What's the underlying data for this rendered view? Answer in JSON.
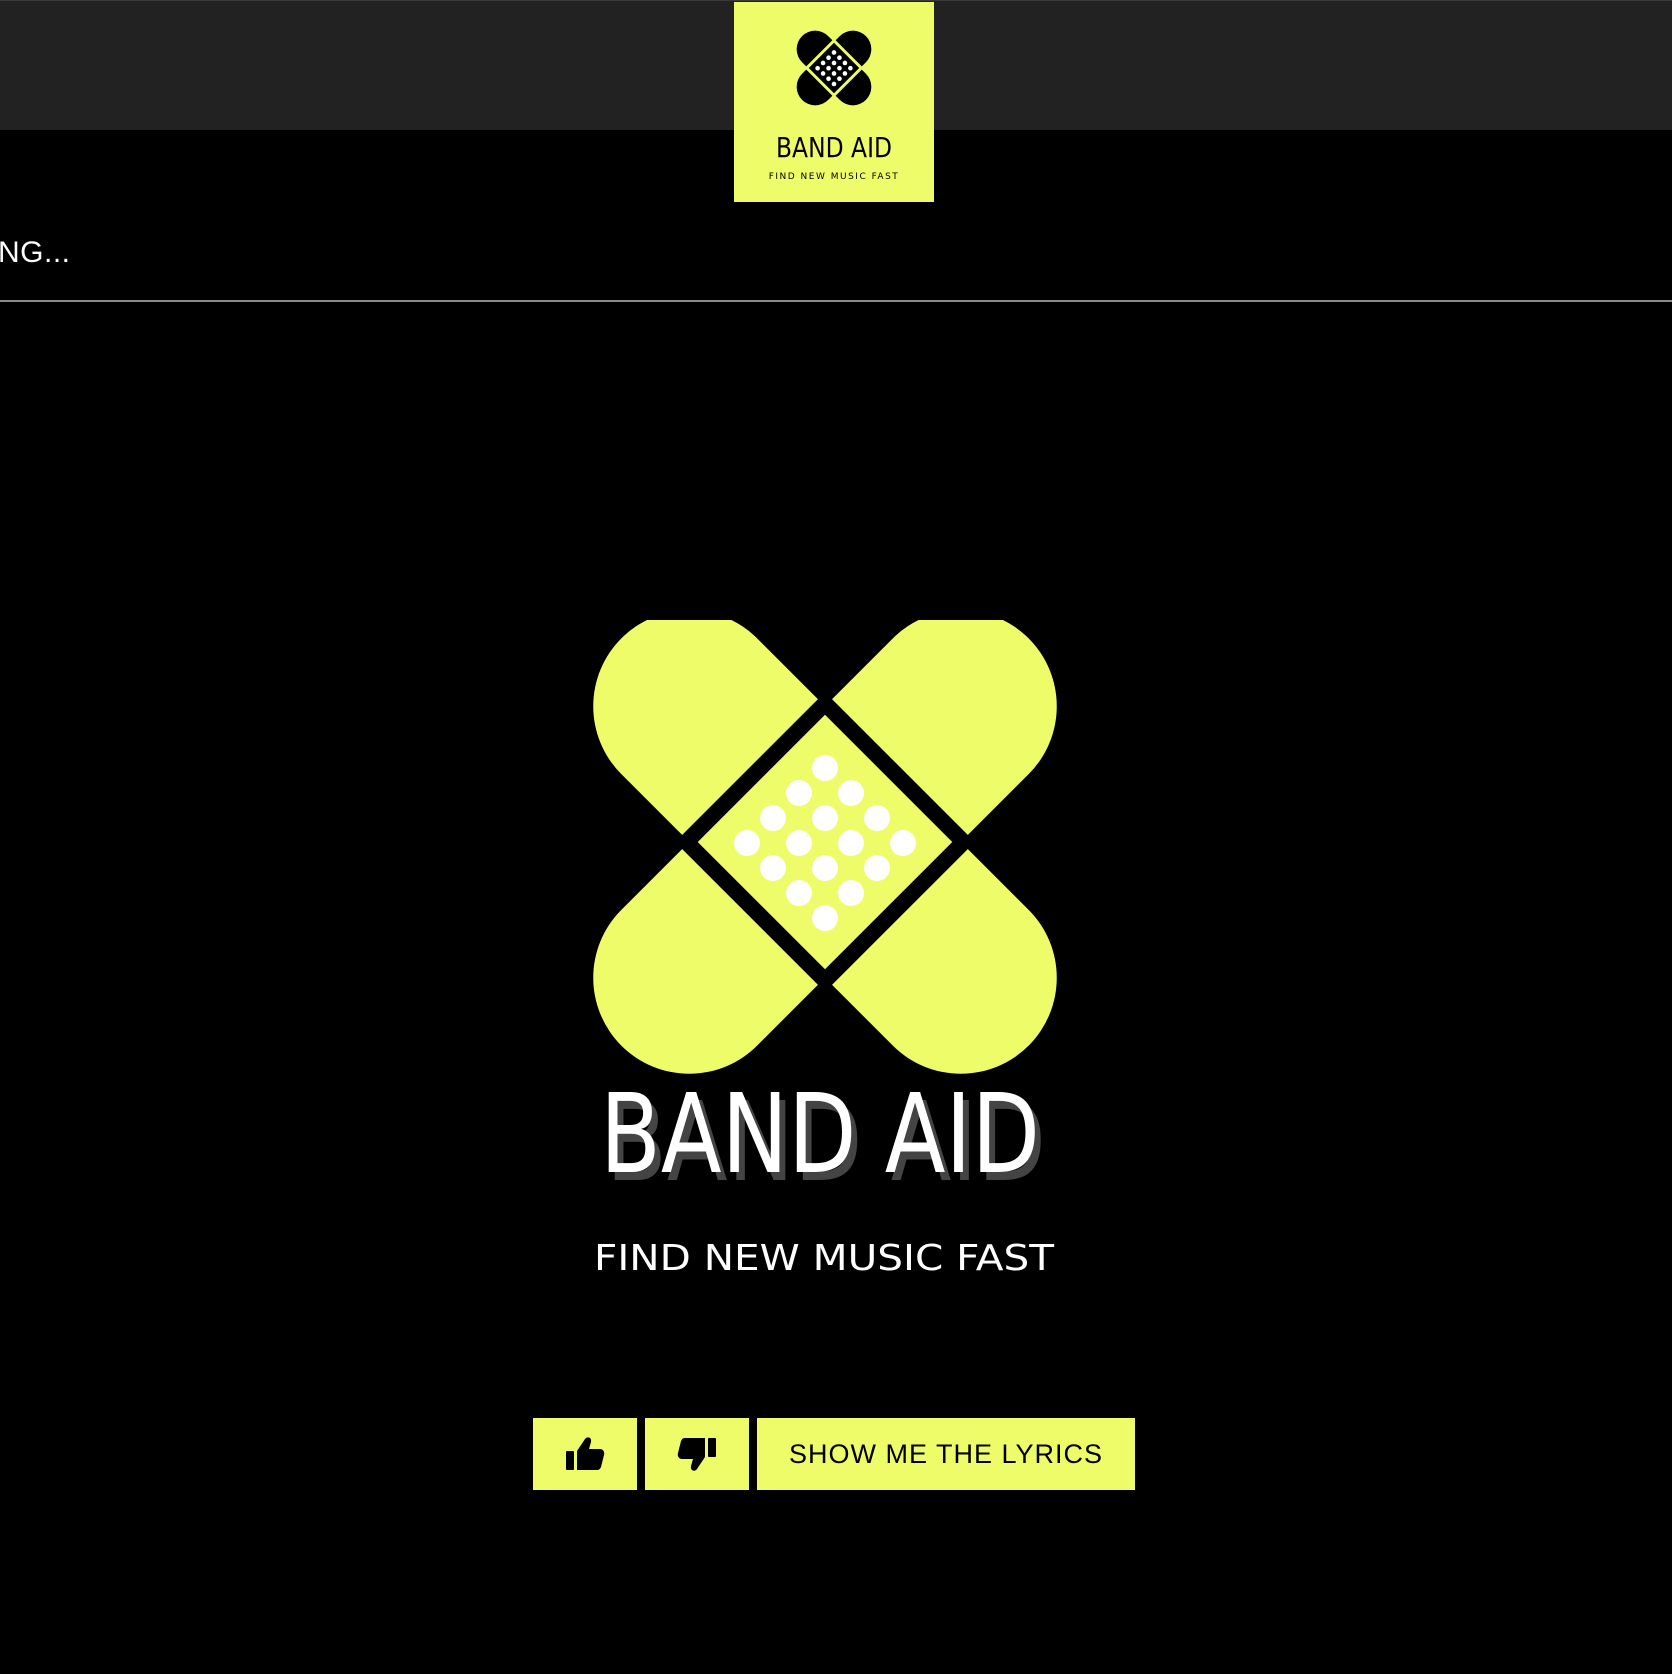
{
  "app": {
    "brand_name": "BAND AID",
    "tagline": "FIND NEW MUSIC FAST"
  },
  "status": {
    "text": "NG..."
  },
  "actions": {
    "like_icon": "thumbs-up-icon",
    "dislike_icon": "thumbs-down-icon",
    "lyrics_label": "SHOW ME THE LYRICS"
  },
  "colors": {
    "accent": "#eefc6a",
    "background": "#000000",
    "topbar": "#222222",
    "text": "#ffffff"
  }
}
